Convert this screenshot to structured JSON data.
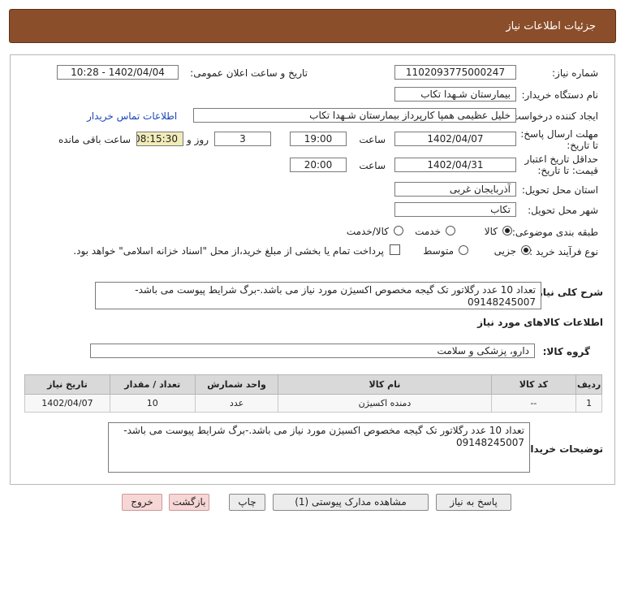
{
  "header": {
    "title": "جزئیات اطلاعات نیاز"
  },
  "form": {
    "need_number_label": "شماره نیاز:",
    "need_number": "1102093775000247",
    "announce_label": "تاریخ و ساعت اعلان عمومی:",
    "announce_value": "1402/04/04 - 10:28",
    "buyer_org_label": "نام دستگاه خریدار:",
    "buyer_org": "بیمارستان شـهدا تکاب",
    "requester_label": "ایجاد کننده درخواست:",
    "requester": "خلیل عظیمی همپا کارپرداز بیمارستان شـهدا تکاب",
    "contact_link": "اطلاعات تماس خریدار",
    "reply_deadline_label": "مهلت ارسال پاسخ: تا تاریخ:",
    "reply_date": "1402/04/07",
    "time_label": "ساعت",
    "reply_time": "19:00",
    "days_value": "3",
    "days_label": "روز و",
    "remaining_time": "08:15:30",
    "remaining_label": "ساعت باقی مانده",
    "validity_label": "حداقل تاریخ اعتبار قیمت: تا تاریخ:",
    "validity_date": "1402/04/31",
    "validity_time": "20:00",
    "province_label": "استان محل تحویل:",
    "province": "آذربایجان غربی",
    "city_label": "شهر محل تحویل:",
    "city": "تکاب",
    "category_label": "طبقه بندی موضوعی:",
    "category_options": [
      "کالا",
      "خدمت",
      "کالا/خدمت"
    ],
    "purchase_type_label": "نوع فرآیند خرید :",
    "purchase_options": [
      "جزیی",
      "متوسط"
    ],
    "treasury_note": "پرداخت تمام یا بخشی از مبلغ خرید،از محل \"اسناد خزانه اسلامی\" خواهد بود."
  },
  "summary": {
    "label": "شرح کلی نیاز:",
    "text": "تعداد 10 عدد رگلاتور تک گیجه مخصوص اکسیژن مورد نیاز می باشد.-برگ شرایط پیوست می باشد- 09148245007"
  },
  "goods": {
    "section_title": "اطلاعات کالاهای مورد نیاز",
    "group_label": "گروه کالا:",
    "group_value": "دارو، پزشکی و سلامت",
    "columns": [
      "ردیف",
      "کد کالا",
      "نام کالا",
      "واحد شمارش",
      "تعداد / مقدار",
      "تاریخ نیاز"
    ],
    "rows": [
      [
        "1",
        "--",
        "دمنده اکسیژن",
        "عدد",
        "10",
        "1402/04/07"
      ]
    ]
  },
  "buyer_notes": {
    "label": "توضیحات خریدار:",
    "text": "تعداد 10 عدد رگلاتور تک گیجه مخصوص اکسیژن مورد نیاز می باشد.-برگ شرایط پیوست می باشد- 09148245007"
  },
  "buttons": {
    "reply": "پاسخ به نیاز",
    "attachments": "مشاهده مدارک پیوستی (1)",
    "print": "چاپ",
    "back": "بازگشت",
    "exit": "خروج"
  },
  "colors": {
    "header": "#8b4e2a",
    "remaining_bg": "#f1ebb8",
    "link": "#1a46b8"
  }
}
